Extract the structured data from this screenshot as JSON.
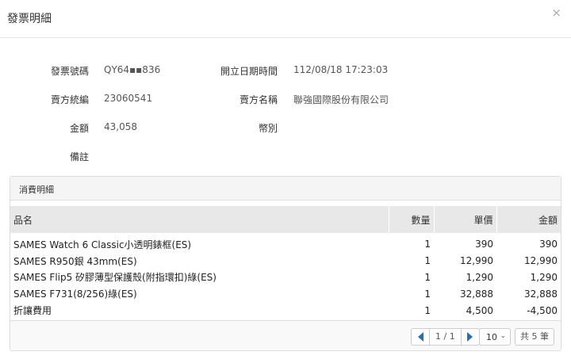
{
  "modal": {
    "title": "發票明細",
    "close": "×"
  },
  "invoice": {
    "number_label": "發票號碼",
    "number_value": "QY64▪▪836",
    "date_label": "開立日期時間",
    "date_value": "112/08/18  17:23:03",
    "seller_id_label": "賣方統編",
    "seller_id_value": "23060541",
    "seller_name_label": "賣方名稱",
    "seller_name_value": "聯強國際股份有限公司",
    "amount_label": "金額",
    "amount_value": "43,058",
    "currency_label": "幣別",
    "currency_value": "",
    "remark_label": "備註",
    "remark_value": ""
  },
  "details": {
    "heading": "消費明細",
    "columns": [
      "品名",
      "數量",
      "單價",
      "金額"
    ],
    "rows": [
      [
        "SAMES  Watch  6  Classic小透明錶框(ES)",
        "1",
        "390",
        "390"
      ],
      [
        "SAMES  R950銀  43mm(ES)",
        "1",
        "12,990",
        "12,990"
      ],
      [
        "SAMES  Flip5  矽膠薄型保護殼(附指環扣)綠(ES)",
        "1",
        "1,290",
        "1,290"
      ],
      [
        "SAMES  F731(8/256)綠(ES)",
        "1",
        "32,888",
        "32,888"
      ],
      [
        "折讓費用",
        "1",
        "4,500",
        "-4,500"
      ]
    ]
  },
  "pagination": {
    "page_info": "1 / 1",
    "page_size": "10",
    "total": "共 5 筆"
  }
}
